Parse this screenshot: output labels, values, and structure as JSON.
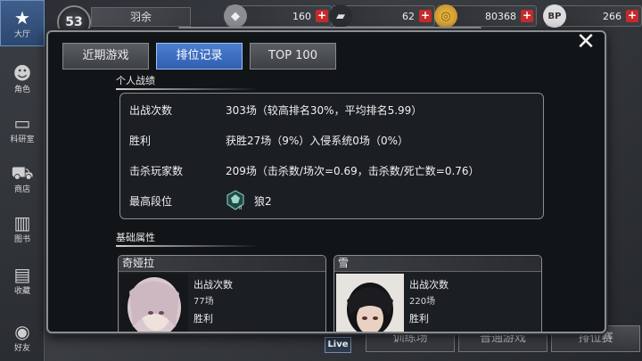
{
  "sidebar": {
    "items": [
      {
        "label": "大厅",
        "icon": "star-icon",
        "active": true
      },
      {
        "label": "角色",
        "icon": "person-icon"
      },
      {
        "label": "科研室",
        "icon": "monitor-icon"
      },
      {
        "label": "商店",
        "icon": "cart-icon"
      },
      {
        "label": "图书",
        "icon": "books-icon"
      },
      {
        "label": "收藏",
        "icon": "book-icon"
      },
      {
        "label": "好友",
        "icon": "gamepad-icon"
      }
    ]
  },
  "topbar": {
    "level": "53",
    "player_name": "羽余",
    "resources": [
      {
        "icon": "crystal-icon",
        "value": "160"
      },
      {
        "icon": "ticket-icon",
        "value": "62"
      },
      {
        "icon": "coin-icon",
        "value": "80368"
      },
      {
        "icon": "bp-icon",
        "icon_text": "BP",
        "value": "266"
      }
    ]
  },
  "bottom": {
    "live": "Live",
    "tabs": [
      "训练场",
      "普通游戏",
      "排位赛"
    ]
  },
  "modal": {
    "close": "✕",
    "tabs": [
      "近期游戏",
      "排位记录",
      "TOP 100"
    ],
    "active_tab": "排位记录",
    "personal": {
      "title": "个人战绩",
      "rows": [
        {
          "label": "出战次数",
          "value": "303场（较高排名30%，平均排名5.99）"
        },
        {
          "label": "胜利",
          "value": "获胜27场（9%）入侵系统0场（0%）"
        },
        {
          "label": "击杀玩家数",
          "value": "209场（击杀数/场次=0.69，击杀数/死亡数=0.76）"
        },
        {
          "label": "最高段位",
          "value": "狼2",
          "rank_icon": "wolf-rank-icon",
          "rank_numeral": "II"
        }
      ]
    },
    "basic": {
      "title": "基础属性",
      "characters": [
        {
          "name": "奇娅拉",
          "stat1_label": "出战次数",
          "stat1_value": "77场",
          "stat2_label": "胜利"
        },
        {
          "name": "雪",
          "stat1_label": "出战次数",
          "stat1_value": "220场",
          "stat2_label": "胜利"
        }
      ]
    }
  }
}
